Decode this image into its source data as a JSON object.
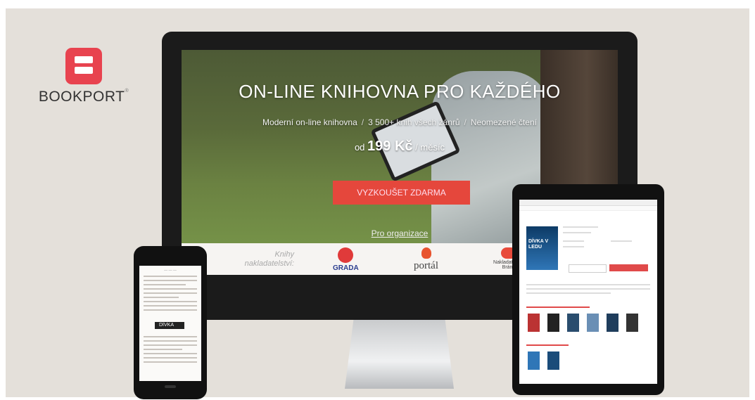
{
  "brand": {
    "name": "BOOKPORT",
    "mark": "®"
  },
  "hero": {
    "title": "ON-LINE KNIHOVNA PRO KAŽDÉHO",
    "features": [
      "Moderní on-line knihovna",
      "3 500+ knih všech žánrů",
      "Neomezené čtení"
    ],
    "price_prefix": "od",
    "price": "199 Kč",
    "price_suffix": "/ měsíc",
    "cta_label": "VYZKOUŠET ZDARMA",
    "org_link": "Pro organizace"
  },
  "publishers": {
    "label": "Knihy nakladatelství:",
    "items": [
      "GRADA",
      "portál",
      "Nakladatelství Brána"
    ]
  },
  "tablet": {
    "book_title": "DÍVKA V LEDU"
  },
  "phone": {
    "cover_text": "DÍVKA"
  },
  "colors": {
    "accent": "#e8434f",
    "cta": "#e5473c",
    "background": "#e4e0da"
  }
}
